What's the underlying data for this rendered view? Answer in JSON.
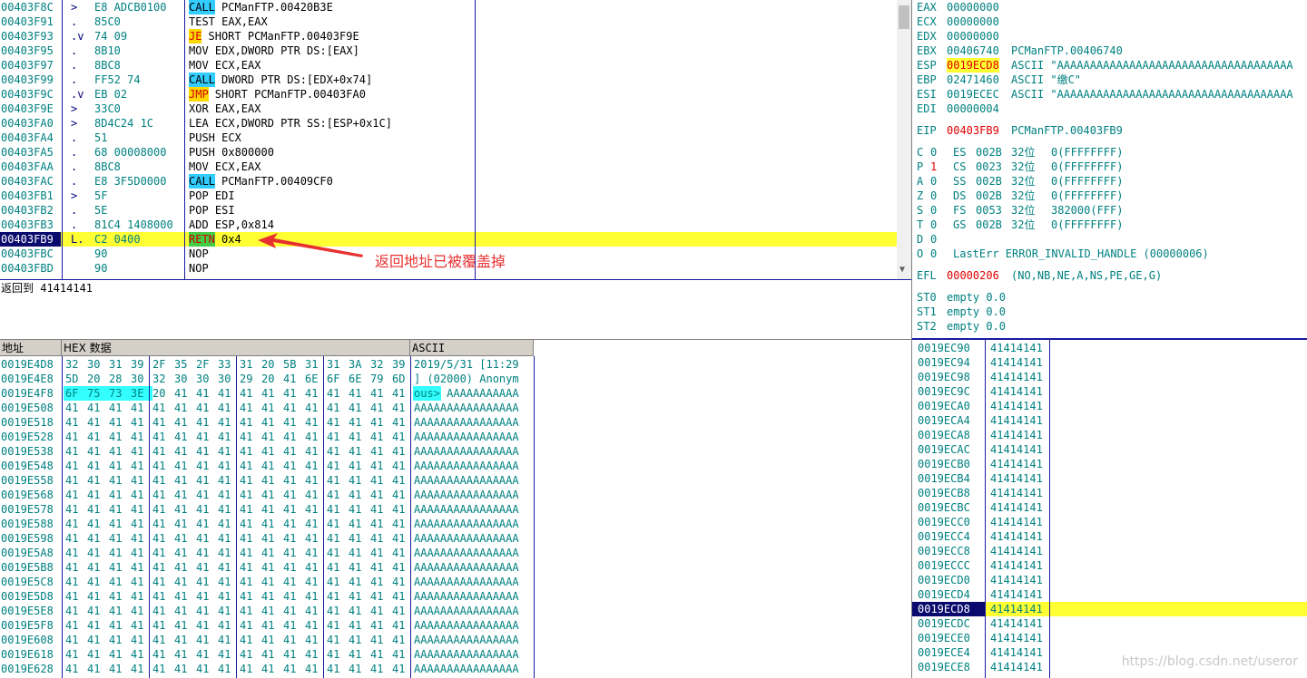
{
  "disasm": {
    "rows": [
      {
        "addr": "00403F8C",
        "mark": ">",
        "hex": "E8 ADCB0100",
        "instr": "PCManFTP.00420B3E",
        "mn": "CALL"
      },
      {
        "addr": "00403F91",
        "mark": ".",
        "hex": "85C0",
        "instr": "TEST EAX,EAX",
        "mn": ""
      },
      {
        "addr": "00403F93",
        "mark": ".v",
        "hex": "74 09",
        "instr": "SHORT PCManFTP.00403F9E",
        "mn": "JE"
      },
      {
        "addr": "00403F95",
        "mark": ".",
        "hex": "8B10",
        "instr": "MOV EDX,DWORD PTR DS:[EAX]",
        "mn": ""
      },
      {
        "addr": "00403F97",
        "mark": ".",
        "hex": "8BC8",
        "instr": "MOV ECX,EAX",
        "mn": ""
      },
      {
        "addr": "00403F99",
        "mark": ".",
        "hex": "FF52 74",
        "instr": "DWORD PTR DS:[EDX+0x74]",
        "mn": "CALL"
      },
      {
        "addr": "00403F9C",
        "mark": ".v",
        "hex": "EB 02",
        "instr": "SHORT PCManFTP.00403FA0",
        "mn": "JMP"
      },
      {
        "addr": "00403F9E",
        "mark": ">",
        "hex": "33C0",
        "instr": "XOR EAX,EAX",
        "mn": ""
      },
      {
        "addr": "00403FA0",
        "mark": ">",
        "hex": "8D4C24 1C",
        "instr": "LEA ECX,DWORD PTR SS:[ESP+0x1C]",
        "mn": ""
      },
      {
        "addr": "00403FA4",
        "mark": ".",
        "hex": "51",
        "instr": "PUSH ECX",
        "mn": ""
      },
      {
        "addr": "00403FA5",
        "mark": ".",
        "hex": "68 00008000",
        "instr": "PUSH 0x800000",
        "mn": ""
      },
      {
        "addr": "00403FAA",
        "mark": ".",
        "hex": "8BC8",
        "instr": "MOV ECX,EAX",
        "mn": ""
      },
      {
        "addr": "00403FAC",
        "mark": ".",
        "hex": "E8 3F5D0000",
        "instr": "PCManFTP.00409CF0",
        "mn": "CALL"
      },
      {
        "addr": "00403FB1",
        "mark": ">",
        "hex": "5F",
        "instr": "POP EDI",
        "mn": ""
      },
      {
        "addr": "00403FB2",
        "mark": ".",
        "hex": "5E",
        "instr": "POP ESI",
        "mn": ""
      },
      {
        "addr": "00403FB3",
        "mark": ".",
        "hex": "81C4 1408000",
        "instr": "ADD ESP,0x814",
        "mn": ""
      },
      {
        "addr": "00403FB9",
        "mark": "L.",
        "hex": "C2 0400",
        "instr": "0x4",
        "mn": "RETN",
        "current": true
      },
      {
        "addr": "00403FBC",
        "mark": "",
        "hex": "90",
        "instr": "NOP",
        "mn": ""
      },
      {
        "addr": "00403FBD",
        "mark": "",
        "hex": "90",
        "instr": "NOP",
        "mn": ""
      }
    ],
    "annotation": "返回地址已被覆盖掉",
    "info_line": "返回到 41414141"
  },
  "registers": {
    "gp": [
      {
        "name": "EAX",
        "val": "00000000",
        "rest": ""
      },
      {
        "name": "ECX",
        "val": "00000000",
        "rest": ""
      },
      {
        "name": "EDX",
        "val": "00000000",
        "rest": ""
      },
      {
        "name": "EBX",
        "val": "00406740",
        "rest": "PCManFTP.00406740"
      },
      {
        "name": "ESP",
        "val": "0019ECD8",
        "rest": "ASCII \"AAAAAAAAAAAAAAAAAAAAAAAAAAAAAAAAAAAA",
        "hl": true
      },
      {
        "name": "EBP",
        "val": "02471460",
        "rest": "ASCII \"缴C\""
      },
      {
        "name": "ESI",
        "val": "0019ECEC",
        "rest": "ASCII \"AAAAAAAAAAAAAAAAAAAAAAAAAAAAAAAAAAAA"
      },
      {
        "name": "EDI",
        "val": "00000004",
        "rest": ""
      }
    ],
    "eip": {
      "name": "EIP",
      "val": "00403FB9",
      "rest": "PCManFTP.00403FB9"
    },
    "flags": [
      {
        "f": "C",
        "v": "0",
        "seg": "ES",
        "sel": "002B",
        "bits": "32位",
        "base": "0(FFFFFFFF)"
      },
      {
        "f": "P",
        "v": "1",
        "seg": "CS",
        "sel": "0023",
        "bits": "32位",
        "base": "0(FFFFFFFF)",
        "red": true
      },
      {
        "f": "A",
        "v": "0",
        "seg": "SS",
        "sel": "002B",
        "bits": "32位",
        "base": "0(FFFFFFFF)"
      },
      {
        "f": "Z",
        "v": "0",
        "seg": "DS",
        "sel": "002B",
        "bits": "32位",
        "base": "0(FFFFFFFF)"
      },
      {
        "f": "S",
        "v": "0",
        "seg": "FS",
        "sel": "0053",
        "bits": "32位",
        "base": "382000(FFF)"
      },
      {
        "f": "T",
        "v": "0",
        "seg": "GS",
        "sel": "002B",
        "bits": "32位",
        "base": "0(FFFFFFFF)"
      },
      {
        "f": "D",
        "v": "0",
        "seg": "",
        "sel": "",
        "bits": "",
        "base": ""
      }
    ],
    "lasterr": {
      "f": "O",
      "v": "0",
      "text": "LastErr ERROR_INVALID_HANDLE (00000006)"
    },
    "efl": {
      "name": "EFL",
      "val": "00000206",
      "rest": "(NO,NB,NE,A,NS,PE,GE,G)"
    },
    "fpu": [
      {
        "name": "ST0",
        "rest": "empty 0.0"
      },
      {
        "name": "ST1",
        "rest": "empty 0.0"
      },
      {
        "name": "ST2",
        "rest": "empty 0.0"
      }
    ]
  },
  "dump": {
    "headers": {
      "addr": "地址",
      "hex": "HEX 数据",
      "ascii": "ASCII"
    },
    "rows": [
      {
        "addr": "0019E4D8",
        "b": [
          "32",
          "30",
          "31",
          "39",
          "2F",
          "35",
          "2F",
          "33",
          "31",
          "20",
          "5B",
          "31",
          "31",
          "3A",
          "32",
          "39"
        ],
        "ascii": "2019/5/31 [11:29"
      },
      {
        "addr": "0019E4E8",
        "b": [
          "5D",
          "20",
          "28",
          "30",
          "32",
          "30",
          "30",
          "30",
          "29",
          "20",
          "41",
          "6E",
          "6F",
          "6E",
          "79",
          "6D"
        ],
        "ascii": "] (02000) Anonym"
      },
      {
        "addr": "0019E4F8",
        "b": [
          "6F",
          "75",
          "73",
          "3E",
          "20",
          "41",
          "41",
          "41",
          "41",
          "41",
          "41",
          "41",
          "41",
          "41",
          "41",
          "41"
        ],
        "ascii": "ous> AAAAAAAAAAA",
        "sel": 4
      },
      {
        "addr": "0019E508",
        "b": [
          "41",
          "41",
          "41",
          "41",
          "41",
          "41",
          "41",
          "41",
          "41",
          "41",
          "41",
          "41",
          "41",
          "41",
          "41",
          "41"
        ],
        "ascii": "AAAAAAAAAAAAAAAA"
      },
      {
        "addr": "0019E518",
        "b": [
          "41",
          "41",
          "41",
          "41",
          "41",
          "41",
          "41",
          "41",
          "41",
          "41",
          "41",
          "41",
          "41",
          "41",
          "41",
          "41"
        ],
        "ascii": "AAAAAAAAAAAAAAAA"
      },
      {
        "addr": "0019E528",
        "b": [
          "41",
          "41",
          "41",
          "41",
          "41",
          "41",
          "41",
          "41",
          "41",
          "41",
          "41",
          "41",
          "41",
          "41",
          "41",
          "41"
        ],
        "ascii": "AAAAAAAAAAAAAAAA"
      },
      {
        "addr": "0019E538",
        "b": [
          "41",
          "41",
          "41",
          "41",
          "41",
          "41",
          "41",
          "41",
          "41",
          "41",
          "41",
          "41",
          "41",
          "41",
          "41",
          "41"
        ],
        "ascii": "AAAAAAAAAAAAAAAA"
      },
      {
        "addr": "0019E548",
        "b": [
          "41",
          "41",
          "41",
          "41",
          "41",
          "41",
          "41",
          "41",
          "41",
          "41",
          "41",
          "41",
          "41",
          "41",
          "41",
          "41"
        ],
        "ascii": "AAAAAAAAAAAAAAAA"
      },
      {
        "addr": "0019E558",
        "b": [
          "41",
          "41",
          "41",
          "41",
          "41",
          "41",
          "41",
          "41",
          "41",
          "41",
          "41",
          "41",
          "41",
          "41",
          "41",
          "41"
        ],
        "ascii": "AAAAAAAAAAAAAAAA"
      },
      {
        "addr": "0019E568",
        "b": [
          "41",
          "41",
          "41",
          "41",
          "41",
          "41",
          "41",
          "41",
          "41",
          "41",
          "41",
          "41",
          "41",
          "41",
          "41",
          "41"
        ],
        "ascii": "AAAAAAAAAAAAAAAA"
      },
      {
        "addr": "0019E578",
        "b": [
          "41",
          "41",
          "41",
          "41",
          "41",
          "41",
          "41",
          "41",
          "41",
          "41",
          "41",
          "41",
          "41",
          "41",
          "41",
          "41"
        ],
        "ascii": "AAAAAAAAAAAAAAAA"
      },
      {
        "addr": "0019E588",
        "b": [
          "41",
          "41",
          "41",
          "41",
          "41",
          "41",
          "41",
          "41",
          "41",
          "41",
          "41",
          "41",
          "41",
          "41",
          "41",
          "41"
        ],
        "ascii": "AAAAAAAAAAAAAAAA"
      },
      {
        "addr": "0019E598",
        "b": [
          "41",
          "41",
          "41",
          "41",
          "41",
          "41",
          "41",
          "41",
          "41",
          "41",
          "41",
          "41",
          "41",
          "41",
          "41",
          "41"
        ],
        "ascii": "AAAAAAAAAAAAAAAA"
      },
      {
        "addr": "0019E5A8",
        "b": [
          "41",
          "41",
          "41",
          "41",
          "41",
          "41",
          "41",
          "41",
          "41",
          "41",
          "41",
          "41",
          "41",
          "41",
          "41",
          "41"
        ],
        "ascii": "AAAAAAAAAAAAAAAA"
      },
      {
        "addr": "0019E5B8",
        "b": [
          "41",
          "41",
          "41",
          "41",
          "41",
          "41",
          "41",
          "41",
          "41",
          "41",
          "41",
          "41",
          "41",
          "41",
          "41",
          "41"
        ],
        "ascii": "AAAAAAAAAAAAAAAA"
      },
      {
        "addr": "0019E5C8",
        "b": [
          "41",
          "41",
          "41",
          "41",
          "41",
          "41",
          "41",
          "41",
          "41",
          "41",
          "41",
          "41",
          "41",
          "41",
          "41",
          "41"
        ],
        "ascii": "AAAAAAAAAAAAAAAA"
      },
      {
        "addr": "0019E5D8",
        "b": [
          "41",
          "41",
          "41",
          "41",
          "41",
          "41",
          "41",
          "41",
          "41",
          "41",
          "41",
          "41",
          "41",
          "41",
          "41",
          "41"
        ],
        "ascii": "AAAAAAAAAAAAAAAA"
      },
      {
        "addr": "0019E5E8",
        "b": [
          "41",
          "41",
          "41",
          "41",
          "41",
          "41",
          "41",
          "41",
          "41",
          "41",
          "41",
          "41",
          "41",
          "41",
          "41",
          "41"
        ],
        "ascii": "AAAAAAAAAAAAAAAA"
      },
      {
        "addr": "0019E5F8",
        "b": [
          "41",
          "41",
          "41",
          "41",
          "41",
          "41",
          "41",
          "41",
          "41",
          "41",
          "41",
          "41",
          "41",
          "41",
          "41",
          "41"
        ],
        "ascii": "AAAAAAAAAAAAAAAA"
      },
      {
        "addr": "0019E608",
        "b": [
          "41",
          "41",
          "41",
          "41",
          "41",
          "41",
          "41",
          "41",
          "41",
          "41",
          "41",
          "41",
          "41",
          "41",
          "41",
          "41"
        ],
        "ascii": "AAAAAAAAAAAAAAAA"
      },
      {
        "addr": "0019E618",
        "b": [
          "41",
          "41",
          "41",
          "41",
          "41",
          "41",
          "41",
          "41",
          "41",
          "41",
          "41",
          "41",
          "41",
          "41",
          "41",
          "41"
        ],
        "ascii": "AAAAAAAAAAAAAAAA"
      },
      {
        "addr": "0019E628",
        "b": [
          "41",
          "41",
          "41",
          "41",
          "41",
          "41",
          "41",
          "41",
          "41",
          "41",
          "41",
          "41",
          "41",
          "41",
          "41",
          "41"
        ],
        "ascii": "AAAAAAAAAAAAAAAA"
      }
    ]
  },
  "stack": {
    "rows": [
      {
        "addr": "0019EC90",
        "val": "41414141"
      },
      {
        "addr": "0019EC94",
        "val": "41414141"
      },
      {
        "addr": "0019EC98",
        "val": "41414141"
      },
      {
        "addr": "0019EC9C",
        "val": "41414141"
      },
      {
        "addr": "0019ECA0",
        "val": "41414141"
      },
      {
        "addr": "0019ECA4",
        "val": "41414141"
      },
      {
        "addr": "0019ECA8",
        "val": "41414141"
      },
      {
        "addr": "0019ECAC",
        "val": "41414141"
      },
      {
        "addr": "0019ECB0",
        "val": "41414141"
      },
      {
        "addr": "0019ECB4",
        "val": "41414141"
      },
      {
        "addr": "0019ECB8",
        "val": "41414141"
      },
      {
        "addr": "0019ECBC",
        "val": "41414141"
      },
      {
        "addr": "0019ECC0",
        "val": "41414141"
      },
      {
        "addr": "0019ECC4",
        "val": "41414141"
      },
      {
        "addr": "0019ECC8",
        "val": "41414141"
      },
      {
        "addr": "0019ECCC",
        "val": "41414141"
      },
      {
        "addr": "0019ECD0",
        "val": "41414141"
      },
      {
        "addr": "0019ECD4",
        "val": "41414141"
      },
      {
        "addr": "0019ECD8",
        "val": "41414141",
        "current": true
      },
      {
        "addr": "0019ECDC",
        "val": "41414141"
      },
      {
        "addr": "0019ECE0",
        "val": "41414141"
      },
      {
        "addr": "0019ECE4",
        "val": "41414141"
      },
      {
        "addr": "0019ECE8",
        "val": "41414141"
      }
    ]
  },
  "watermark": "https://blog.csdn.net/useror",
  "colors": {
    "accent_yellow": "#ffff33",
    "call_bg": "#33ccff",
    "sel_addr_bg": "#0a0a6e",
    "teal": "#008080",
    "red": "#e00000"
  }
}
